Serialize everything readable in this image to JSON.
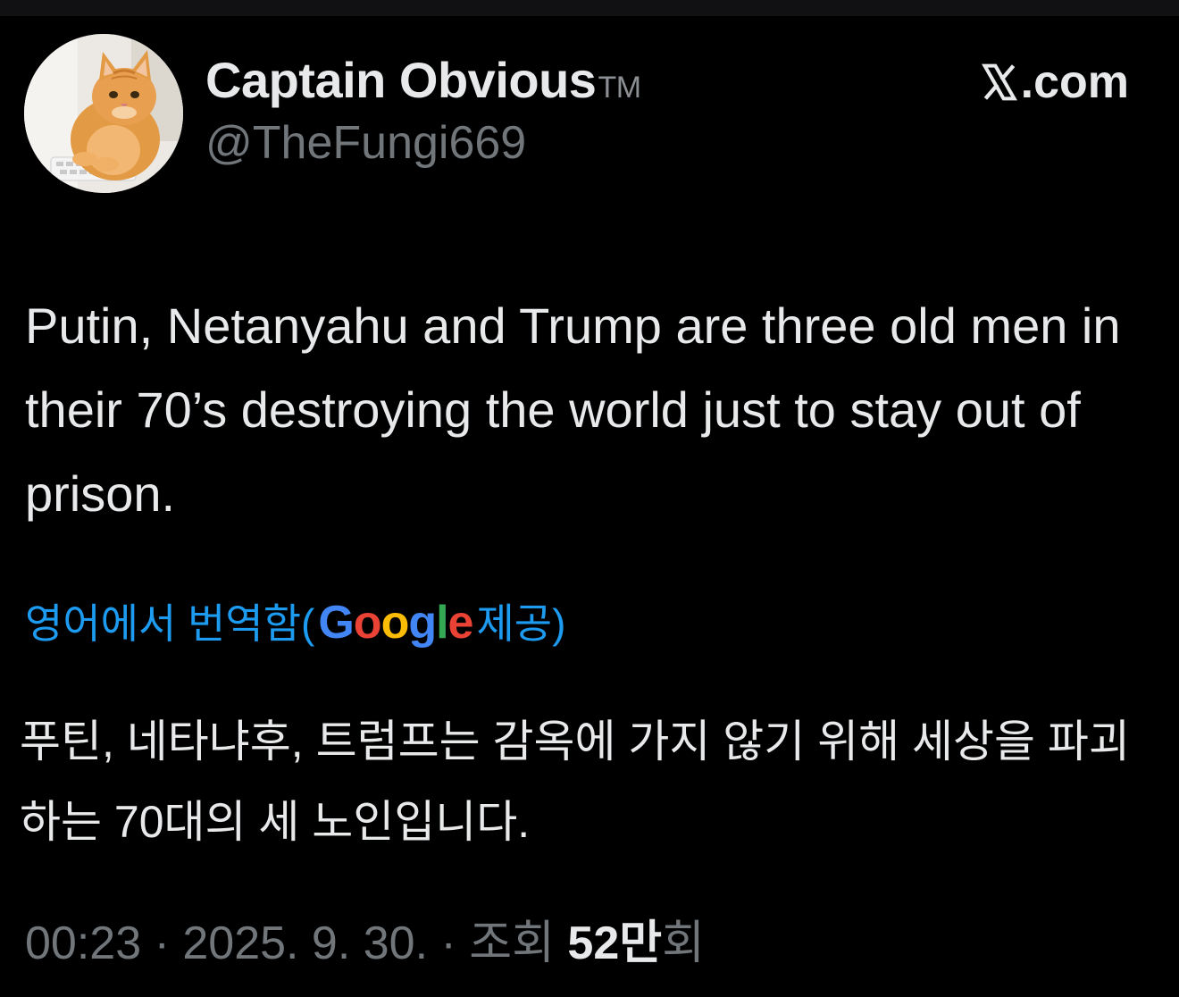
{
  "author": {
    "display_name": "Captain Obvious",
    "badge": "TM",
    "handle": "@TheFungi669",
    "avatar_icon": "orange-cat-avatar"
  },
  "brand": {
    "label": ".com",
    "icon": "x-logo-icon"
  },
  "tweet": {
    "text": "Putin, Netanyahu and Trump are three old men in their 70’s destroying the world just to stay out of prison."
  },
  "translation": {
    "prefix": "영어에서 번역함(",
    "google_letters": [
      "G",
      "o",
      "o",
      "g",
      "l",
      "e"
    ],
    "suffix": " 제공)",
    "text": "푸틴, 네타냐후, 트럼프는 감옥에 가지 않기 위해 세상을 파괴하는 70대의 세 노인입니다."
  },
  "meta": {
    "time": "00:23",
    "sep1": " · ",
    "date": "2025. 9. 30.",
    "sep2": " · ",
    "views_label": "조회 ",
    "views_count": "52만",
    "views_unit": "회"
  },
  "colors": {
    "background": "#000000",
    "text": "#e7e9ea",
    "secondary": "#71767b",
    "link": "#1d9bf0"
  }
}
